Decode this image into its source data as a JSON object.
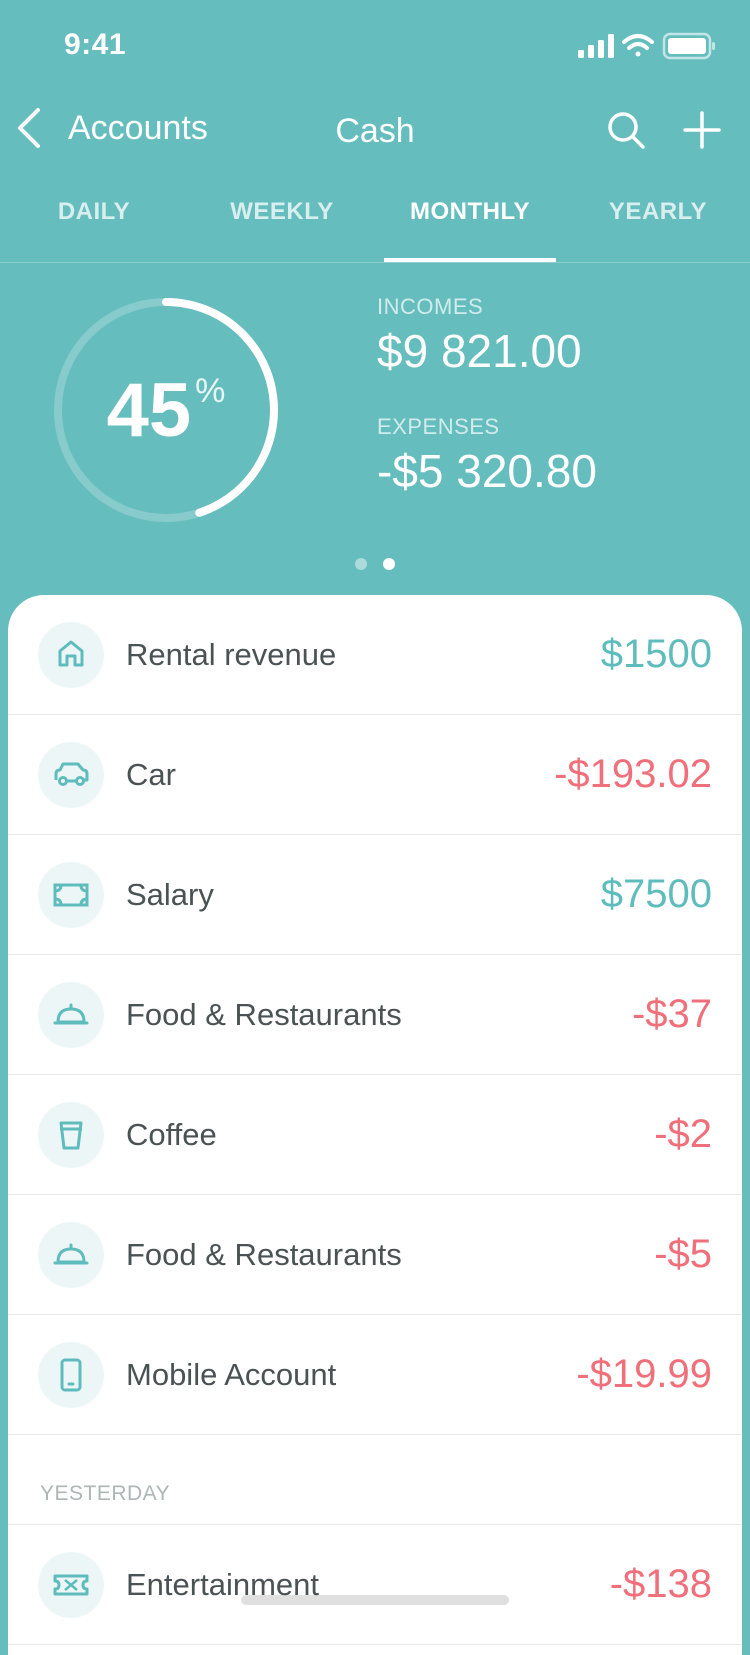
{
  "status_bar": {
    "time": "9:41"
  },
  "nav": {
    "back_label": "Accounts",
    "title": "Cash"
  },
  "tabs": [
    {
      "label": "DAILY",
      "active": false
    },
    {
      "label": "WEEKLY",
      "active": false
    },
    {
      "label": "MONTHLY",
      "active": true
    },
    {
      "label": "YEARLY",
      "active": false
    }
  ],
  "summary": {
    "percent": 45,
    "percent_text": "45",
    "percent_unit": "%",
    "incomes_label": "INCOMES",
    "incomes_value": "$9 821.00",
    "expenses_label": "EXPENSES",
    "expenses_value": "-$5 320.80",
    "page_index": 2,
    "page_count": 2
  },
  "colors": {
    "accent": "#66BDBE",
    "income": "#5FBCBD",
    "expense": "#F06F7A"
  },
  "transactions": [
    {
      "icon": "house-icon",
      "label": "Rental revenue",
      "amount": "$1500",
      "type": "income"
    },
    {
      "icon": "car-icon",
      "label": "Car",
      "amount": "-$193.02",
      "type": "expense"
    },
    {
      "icon": "banknote-icon",
      "label": "Salary",
      "amount": "$7500",
      "type": "income"
    },
    {
      "icon": "cloche-icon",
      "label": "Food & Restaurants",
      "amount": "-$37",
      "type": "expense"
    },
    {
      "icon": "coffee-cup-icon",
      "label": "Coffee",
      "amount": "-$2",
      "type": "expense"
    },
    {
      "icon": "cloche-icon",
      "label": "Food & Restaurants",
      "amount": "-$5",
      "type": "expense"
    },
    {
      "icon": "phone-icon",
      "label": "Mobile Account",
      "amount": "-$19.99",
      "type": "expense"
    }
  ],
  "yesterday": {
    "header": "YESTERDAY",
    "transactions": [
      {
        "icon": "ticket-icon",
        "label": "Entertainment",
        "amount": "-$138",
        "type": "expense"
      }
    ]
  }
}
